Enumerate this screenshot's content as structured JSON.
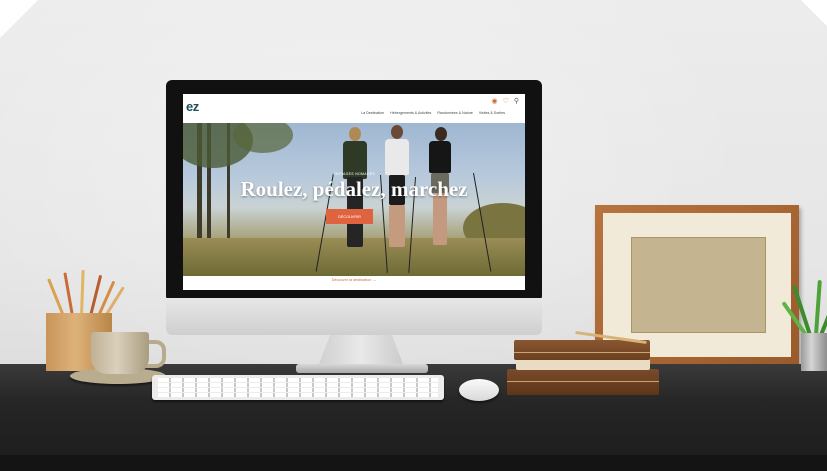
{
  "website": {
    "logo": "ez",
    "nav_items": [
      "La Destination",
      "Hébergements & Activités",
      "Randonnées & Nature",
      "Visites & Sorties"
    ],
    "icons": [
      "backpack-icon",
      "heart-icon",
      "search-icon"
    ],
    "hero": {
      "kicker": "PAYSAGES NOMADES",
      "title": "Roulez, pédalez, marchez",
      "button_label": "DÉCOUVRIR"
    },
    "footer_link": "Découvrir la destination →"
  },
  "colors": {
    "brand_teal": "#1f4e5a",
    "accent_orange": "#e0633f",
    "desk": "#262626",
    "wall": "#e6e6e6",
    "frame_wood": "#b8743d"
  }
}
